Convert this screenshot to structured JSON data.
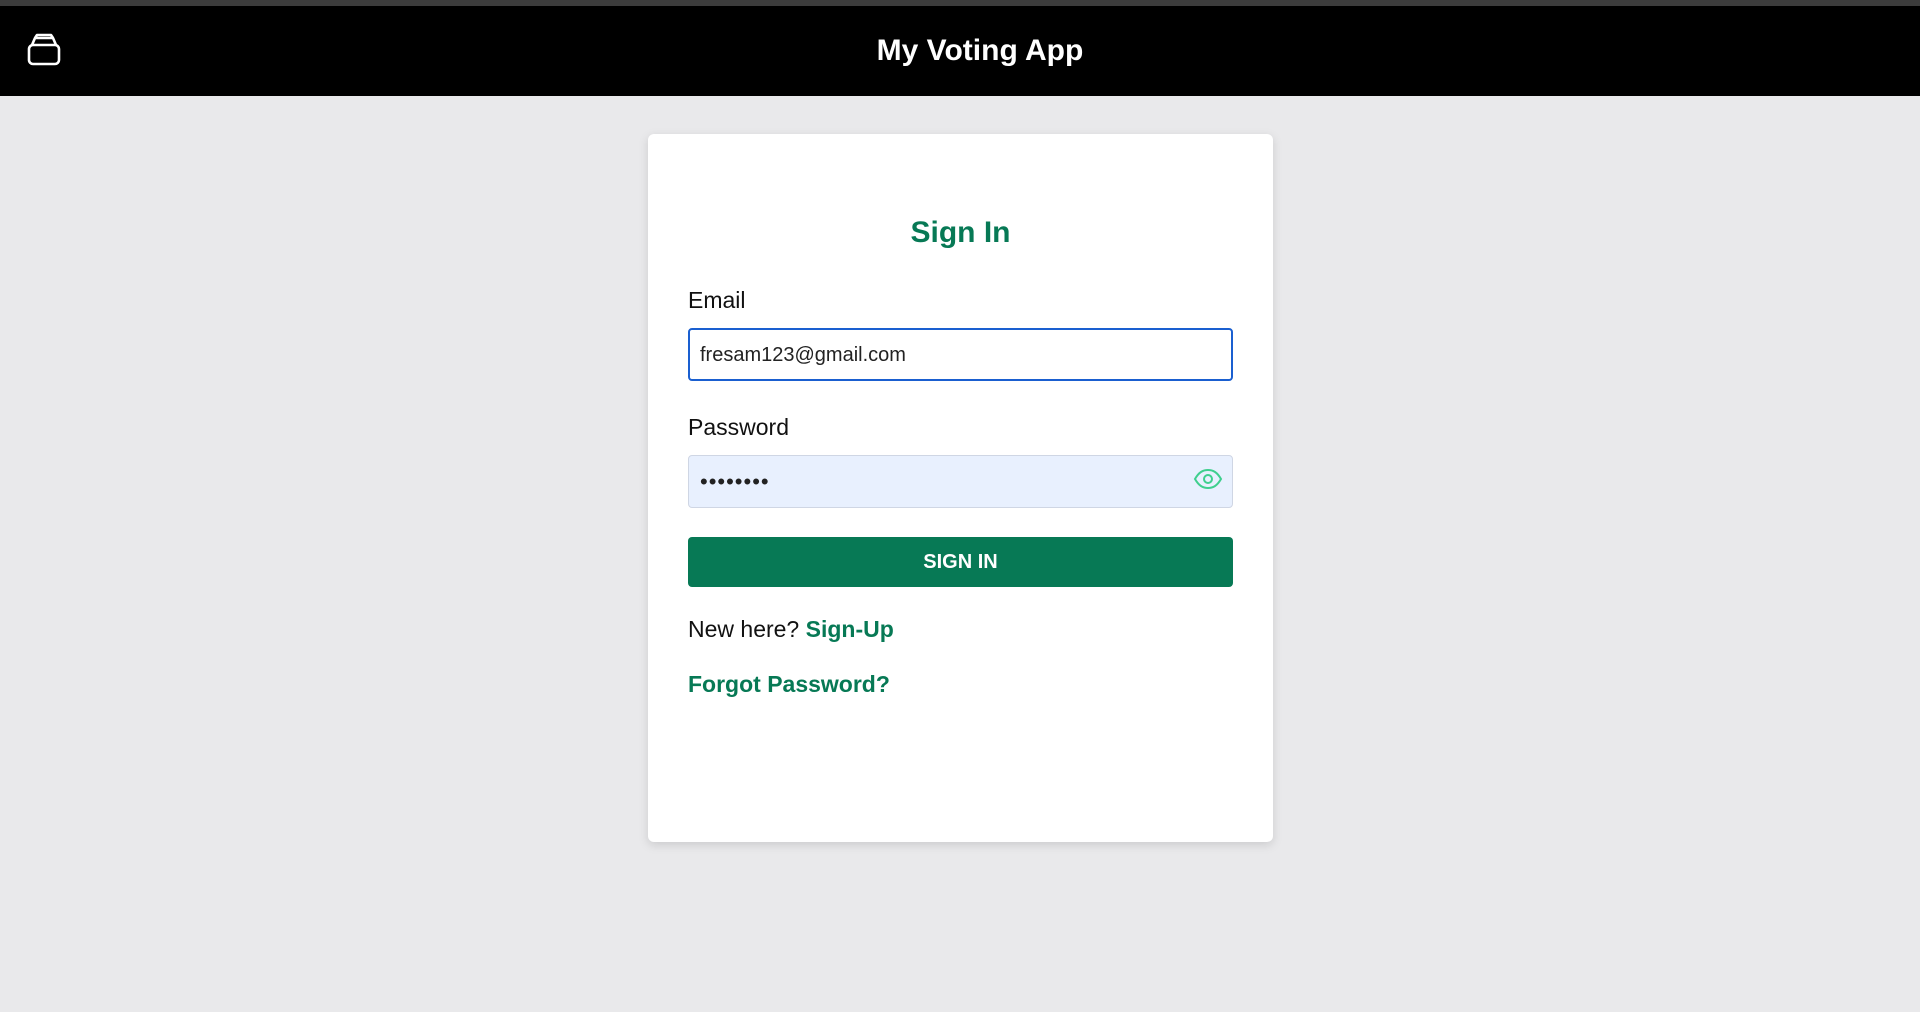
{
  "app": {
    "title": "My Voting App",
    "menu_icon": "stack-icon"
  },
  "signin_form": {
    "heading": "Sign In",
    "email": {
      "label": "Email",
      "value": "fresam123@gmail.com"
    },
    "password": {
      "label": "Password",
      "value": "••••••••",
      "toggle_icon": "eye-icon"
    },
    "submit_label": "SIGN IN",
    "new_here_text": "New here?",
    "signup_link": "Sign-Up",
    "forgot_link": "Forgot Password?"
  },
  "colors": {
    "brand_green": "#077955",
    "navbar": "#000000",
    "background": "#e9e9eb",
    "focus_border": "#1a5fd0",
    "autofill_bg": "#e8f0fe",
    "eye_icon": "#3fcf8e"
  }
}
